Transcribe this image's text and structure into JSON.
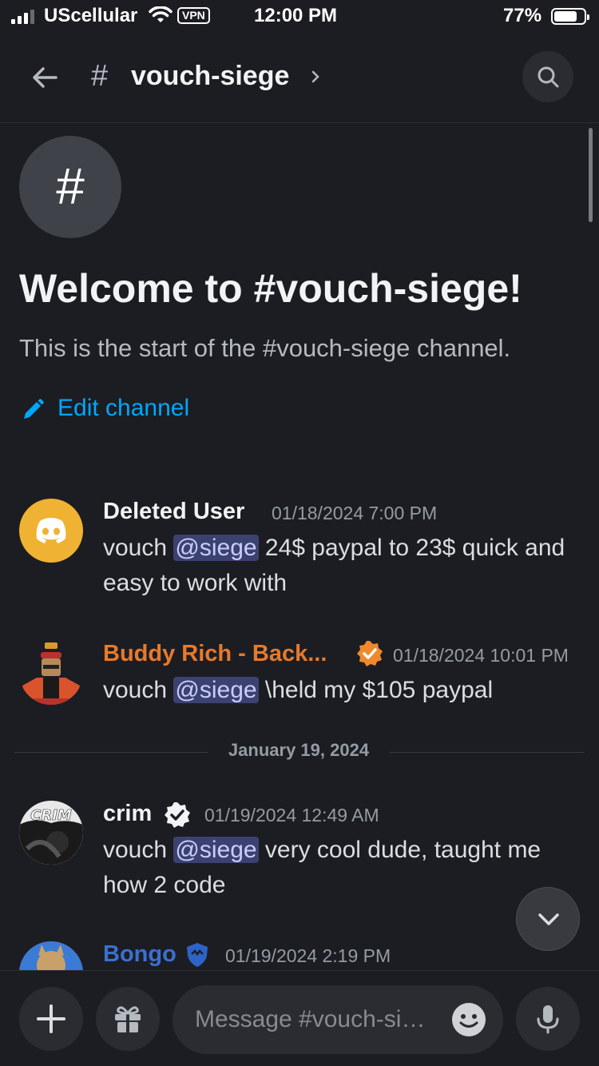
{
  "status_bar": {
    "carrier": "UScellular",
    "vpn": "VPN",
    "time": "12:00 PM",
    "battery": "77%",
    "battery_level": 0.77
  },
  "header": {
    "hash": "#",
    "channel": "vouch-siege"
  },
  "welcome": {
    "icon": "#",
    "title": "Welcome to #vouch-siege!",
    "subtitle": "This is the start of the #vouch-siege channel.",
    "edit_label": "Edit channel"
  },
  "messages": [
    {
      "author": "Deleted User",
      "author_color": "#f2f3f5",
      "timestamp": "01/18/2024 7:00 PM",
      "pre": "vouch ",
      "mention": "@siege",
      "post": " 24$ paypal to 23$ quick and easy to work with",
      "avatar_color": "#f0b232"
    },
    {
      "author": "Buddy Rich - Back...",
      "author_color": "#e67a2c",
      "timestamp": "01/18/2024 10:01 PM",
      "pre": "vouch ",
      "mention": "@siege",
      "post": " \\held my $105 paypal",
      "badge_color": "#f0892c"
    },
    {
      "author": "crim",
      "author_color": "#f2f3f5",
      "timestamp": "01/19/2024 12:49 AM",
      "pre": "vouch ",
      "mention": "@siege",
      "post": " very cool dude, taught me how 2 code",
      "avatar_text": "CRIM"
    },
    {
      "author": "Bongo",
      "author_color": "#3b6fd1",
      "timestamp": "01/19/2024 2:19 PM"
    }
  ],
  "date_divider": "January 19, 2024",
  "composer": {
    "placeholder": "Message #vouch-siege"
  },
  "colors": {
    "background": "#1c1d22",
    "link": "#00a8fc",
    "mention_bg": "#3c4270"
  }
}
